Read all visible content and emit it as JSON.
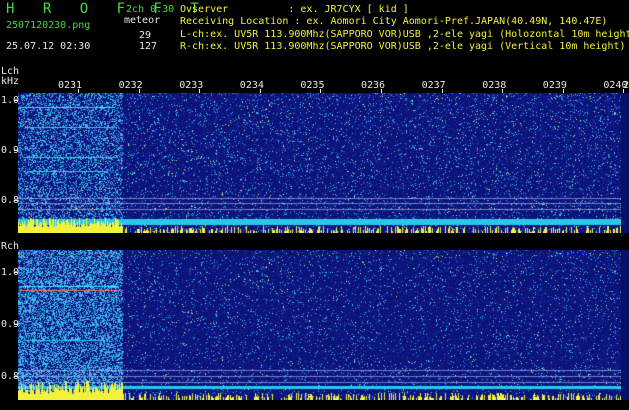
{
  "app": {
    "title": "H R O F F T",
    "mode": "2ch 0.30",
    "file_name": "2507120230.png",
    "meteor_label": "meteor",
    "datetime": "25.07.12 02:30",
    "lch_count": "29",
    "rch_count": "127"
  },
  "info": {
    "observer_line": "Ovserver          : ex. JR7CYX [ kid ]",
    "location_line": "Receiving Location : ex. Aomori City Aomori-Pref.JAPAN(40.49N, 140.47E)",
    "lch_line": "L-ch:ex. UV5R 113.900Mhz(SAPPORO VOR)USB ,2-ele yagi (Holozontal 10m height)",
    "rch_line": "R-ch:ex. UV5R 113.900Mhz(SAPPORO VOR)USB ,2-ele yagi (Vertical 10m height)"
  },
  "axes": {
    "lch_label": "Lch",
    "khz_label": "kHz",
    "rch_label": "Rch",
    "time_ticks": [
      "0231",
      "0232",
      "0233",
      "0234",
      "0235",
      "0236",
      "0237",
      "0238",
      "0239",
      "0240"
    ],
    "time_tick_extra": "2",
    "freq_ticks_l": [
      "1.0",
      "0.9",
      "0.8"
    ],
    "freq_ticks_r": [
      "1.0",
      "0.9",
      "0.8"
    ]
  },
  "colors": {
    "background": "#000000",
    "panel_blue": "#0c137a",
    "noise_cyan": "#2ac8e8",
    "signal_yellow": "#f2f23a",
    "text_green": "#3fdc3f",
    "text_white": "#e8e8e8"
  }
}
